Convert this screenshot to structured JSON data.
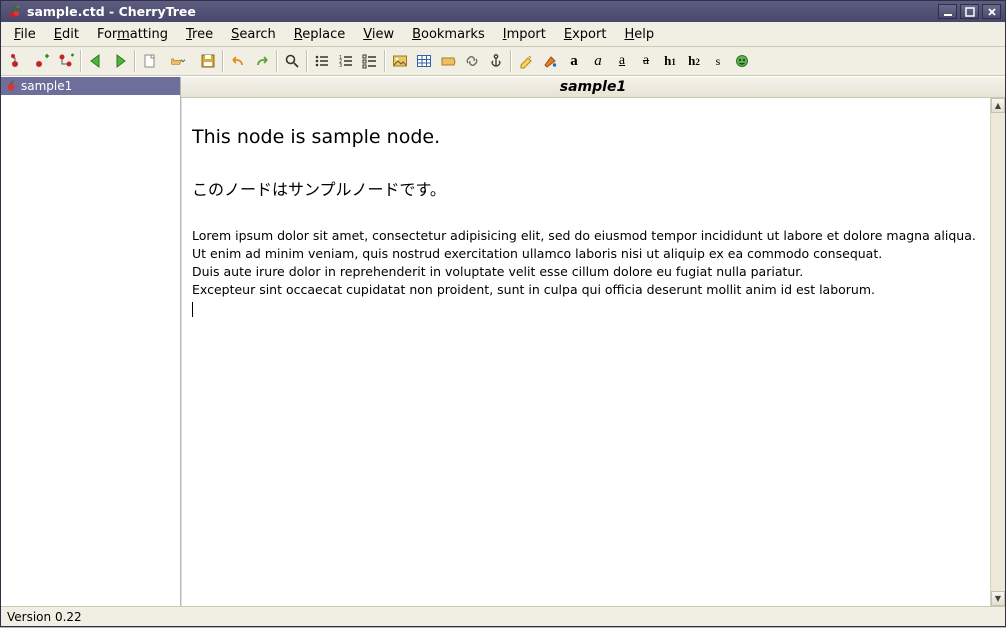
{
  "window": {
    "title": "sample.ctd - CherryTree"
  },
  "menu": {
    "file": "File",
    "edit": "Edit",
    "formatting": "Formatting",
    "tree": "Tree",
    "search": "Search",
    "replace": "Replace",
    "view": "View",
    "bookmarks": "Bookmarks",
    "import": "Import",
    "export": "Export",
    "help": "Help"
  },
  "toolbar": {
    "node_red": "node-with-red",
    "node_add": "node-add",
    "node_sub": "node-subnode",
    "back": "back",
    "forward": "forward",
    "new": "new-document",
    "open": "open-document",
    "save": "save-document",
    "undo": "undo",
    "redo": "redo",
    "find": "find",
    "list_bullet": "bullet-list",
    "list_number": "number-list",
    "list_todo": "todo-list",
    "image": "insert-image",
    "table": "insert-table",
    "codebox": "insert-codebox",
    "link": "insert-link",
    "anchor": "insert-anchor",
    "fmt_clear": "format-clear",
    "fmt_color": "format-color",
    "bold": "bold",
    "italic": "italic",
    "underline": "underline",
    "strike": "strike",
    "h1": "h1",
    "h2": "h2",
    "small": "small",
    "special": "special"
  },
  "tree": {
    "items": [
      {
        "label": "sample1"
      }
    ]
  },
  "editor_node_title": "sample1",
  "content": {
    "heading_large": "This node is sample node.",
    "heading_jp": "このノードはサンプルノードです。",
    "body": "Lorem ipsum dolor sit amet, consectetur adipisicing elit, sed do eiusmod tempor incididunt ut labore et dolore magna aliqua.\nUt enim ad minim veniam, quis nostrud exercitation ullamco laboris nisi ut aliquip ex ea commodo consequat.\nDuis aute irure dolor in reprehenderit in voluptate velit esse cillum dolore eu fugiat nulla pariatur.\nExcepteur sint occaecat cupidatat non proident, sunt in culpa qui officia deserunt mollit anim id est laborum."
  },
  "status": {
    "version": "Version 0.22"
  }
}
